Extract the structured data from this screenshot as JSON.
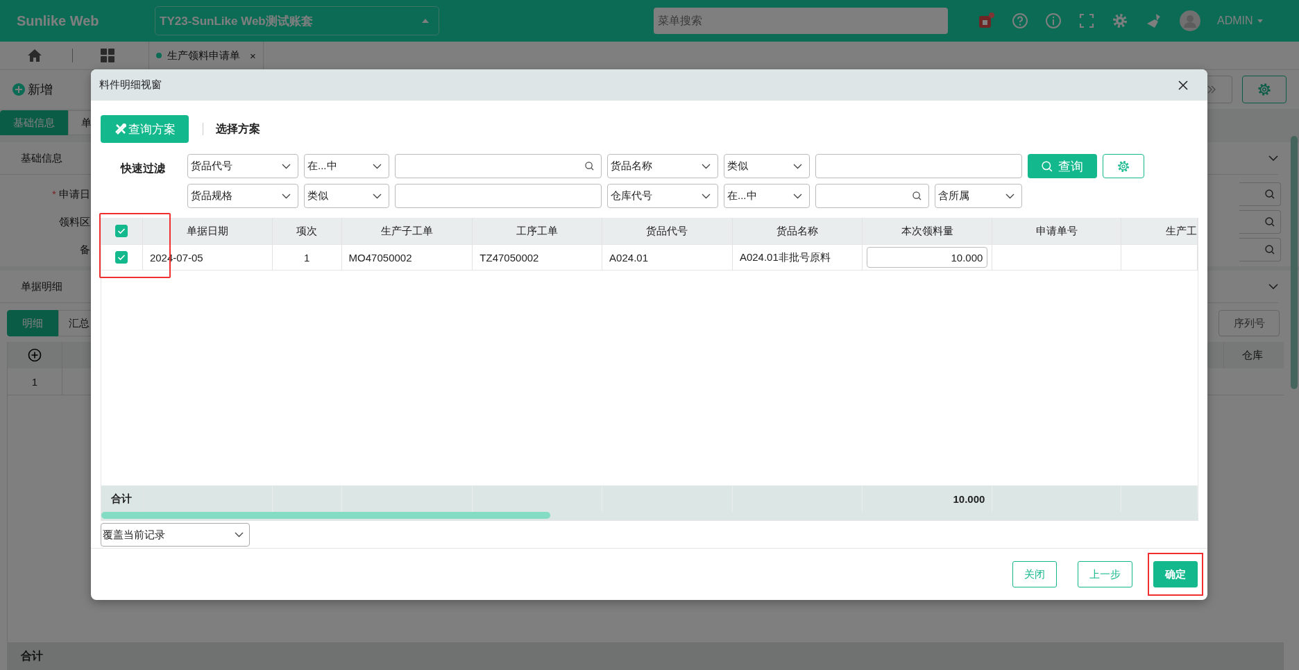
{
  "header": {
    "logo": "Sunlike Web",
    "account": "TY23-SunLike Web测试账套",
    "search": {
      "placeholder": "菜单搜索"
    },
    "user": "ADMIN"
  },
  "page_tabs": [
    {
      "label": "生产领料申请单",
      "selected": true,
      "close": "×"
    }
  ],
  "toolbar": {
    "add": "新增"
  },
  "section_tabs": [
    {
      "label": "基础信息",
      "selected": true
    },
    {
      "label": "单",
      "selected": false
    }
  ],
  "basic_panel": {
    "title": "基础信息",
    "required_mark": "*",
    "fields": [
      {
        "label": "申请日",
        "required": true
      },
      {
        "label": "领料区",
        "required": false
      },
      {
        "label": "备",
        "required": false
      }
    ]
  },
  "detail_panel": {
    "title": "单据明细",
    "tabs": [
      {
        "label": "明细",
        "selected": true
      },
      {
        "label": "汇总",
        "selected": false
      }
    ],
    "serial_button": "序列号",
    "column": "仓库",
    "rows": [
      "1"
    ],
    "total_label": "合计"
  },
  "dialog": {
    "title": "料件明细视窗",
    "scheme_button": "查询方案",
    "choose_scheme": "选择方案",
    "filter_label": "快速过滤",
    "query_button": "查询",
    "filters": [
      [
        {
          "kind": "select",
          "value": "货品代号"
        },
        {
          "kind": "select",
          "value": "在...中"
        },
        {
          "kind": "search"
        },
        {
          "kind": "select",
          "value": "货品名称"
        },
        {
          "kind": "select",
          "value": "类似"
        },
        {
          "kind": "input"
        }
      ],
      [
        {
          "kind": "select",
          "value": "货品规格"
        },
        {
          "kind": "select",
          "value": "类似"
        },
        {
          "kind": "input"
        },
        {
          "kind": "select",
          "value": "仓库代号"
        },
        {
          "kind": "select",
          "value": "在...中"
        },
        {
          "kind": "search"
        },
        {
          "kind": "select",
          "value": "含所属"
        }
      ]
    ],
    "table": {
      "all_checked": true,
      "checkbox_column_highlighted": true,
      "columns": [
        {
          "label": "单据日期",
          "kind": "text"
        },
        {
          "label": "项次",
          "kind": "center"
        },
        {
          "label": "生产子工单",
          "kind": "text"
        },
        {
          "label": "工序工单",
          "kind": "text"
        },
        {
          "label": "货品代号",
          "kind": "text"
        },
        {
          "label": "货品名称",
          "kind": "text"
        },
        {
          "label": "本次领料量",
          "kind": "input"
        },
        {
          "label": "申请单号",
          "kind": "text"
        },
        {
          "label": "生产工",
          "kind": "text"
        }
      ],
      "rows": [
        {
          "selected": true,
          "cells": [
            "2024-07-05",
            "1",
            "MO47050002",
            "TZ47050002",
            "A024.01",
            "A024.01非批号原料",
            "10.000"
          ]
        }
      ],
      "total": {
        "label": "合计",
        "amount": "10.000"
      }
    },
    "mode": "覆盖当前记录",
    "buttons": [
      {
        "label": "关闭",
        "kind": "outline",
        "highlighted": false
      },
      {
        "label": "上一步",
        "kind": "outline",
        "highlighted": false
      },
      {
        "label": "确定",
        "kind": "primary",
        "highlighted": true
      }
    ]
  }
}
